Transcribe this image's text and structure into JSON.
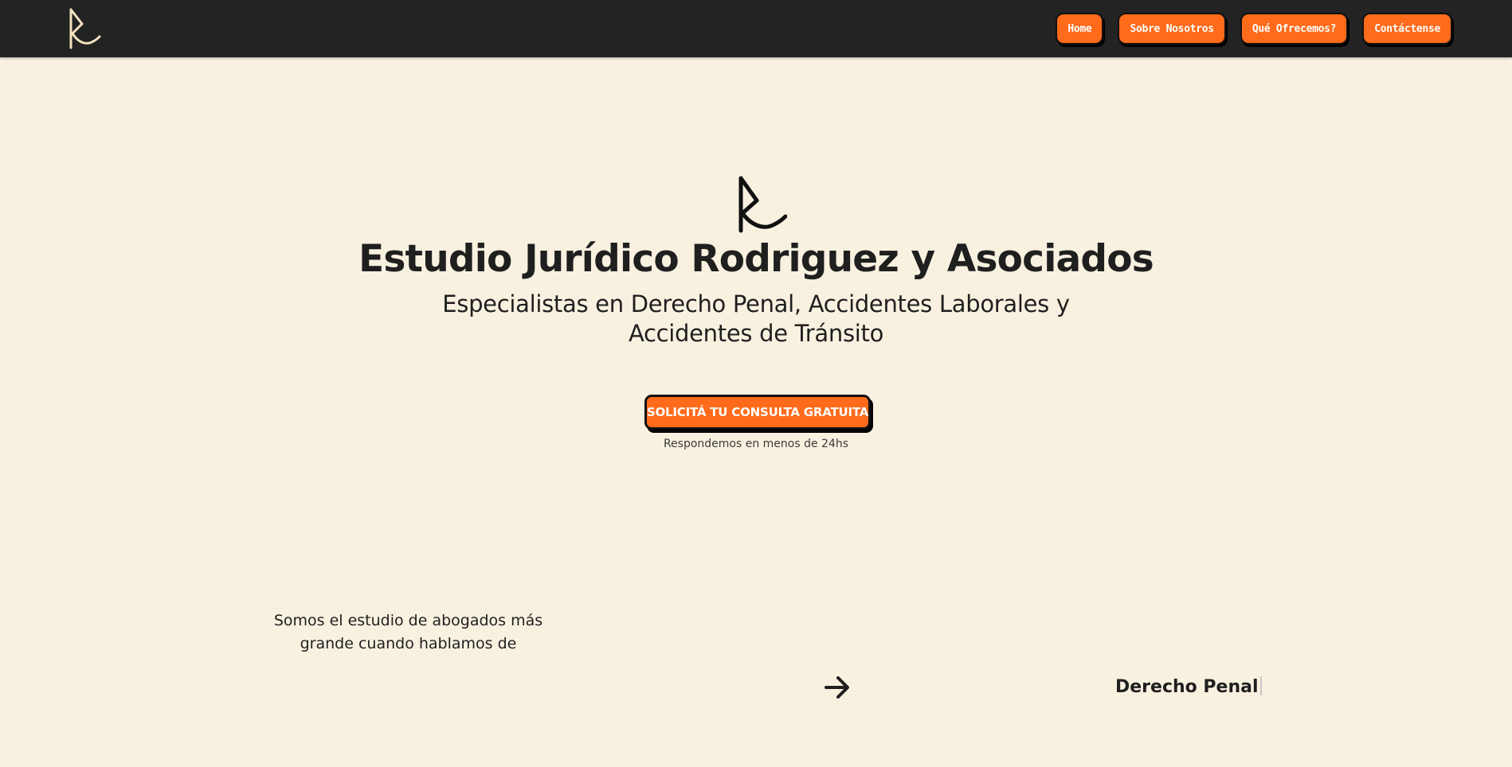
{
  "colors": {
    "accent": "#ff6b1a",
    "header_bg": "#232323",
    "page_bg": "#f9f1e0",
    "text": "#1f1f1f"
  },
  "header": {
    "logo_icon": "rr-monogram-logo-icon",
    "nav": [
      {
        "label": "Home"
      },
      {
        "label": "Sobre Nosotros"
      },
      {
        "label": "Qué Ofrecemos?"
      },
      {
        "label": "Contáctense"
      }
    ]
  },
  "hero": {
    "logo_icon": "rr-monogram-logo-icon",
    "title": "Estudio Jurídico Rodriguez y Asociados",
    "subtitle": "Especialistas en Derecho Penal, Accidentes Laborales y Accidentes de Tránsito",
    "cta_label": "SOLICITÁ TU CONSULTA GRATUITA",
    "cta_note": "Respondemos en menos de 24hs"
  },
  "intro": {
    "text": "Somos el estudio de abogados más grande cuando hablamos de",
    "arrow_icon": "arrow-right-icon",
    "specialty": "Derecho Penal"
  }
}
